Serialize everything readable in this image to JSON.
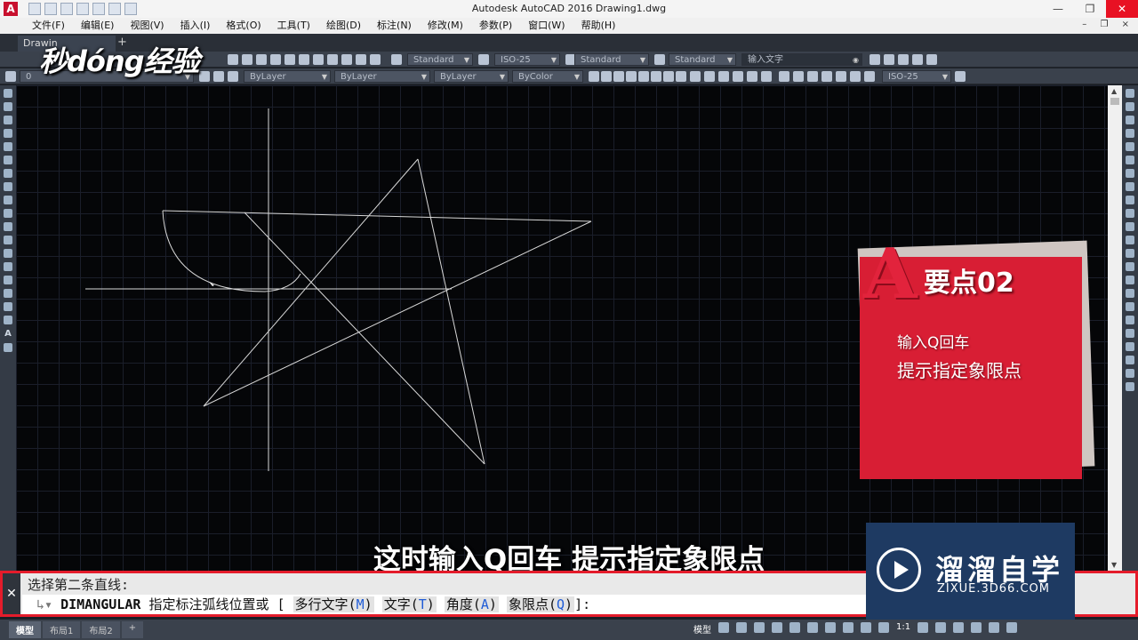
{
  "window": {
    "title": "Autodesk AutoCAD 2016    Drawing1.dwg",
    "controls": [
      "—",
      "❐",
      "✕"
    ]
  },
  "menu": {
    "items": [
      "文件(F)",
      "编辑(E)",
      "视图(V)",
      "插入(I)",
      "格式(O)",
      "工具(T)",
      "绘图(D)",
      "标注(N)",
      "修改(M)",
      "参数(P)",
      "窗口(W)",
      "帮助(H)"
    ]
  },
  "file_tab": {
    "label": "Drawin",
    "add": "+"
  },
  "watermark": {
    "text": "秒dóng经验"
  },
  "toolbar": {
    "text_style": "Standard",
    "dim_style": "ISO-25",
    "table_style": "Standard",
    "mleader_style": "Standard",
    "search_placeholder": "输入文字",
    "layer_current": "0",
    "color": "ByLayer",
    "linetype": "ByLayer",
    "lineweight": "ByLayer",
    "plotstyle": "ByColor",
    "dim_style_2": "ISO-25"
  },
  "left_tools": {
    "text_tool": "A"
  },
  "keypoint": {
    "big_letter": "A",
    "heading": "要点02",
    "line1": "输入Q回车",
    "line2": "提示指定象限点"
  },
  "subtitle": "这时输入Q回车 提示指定象限点",
  "brand": {
    "name": "溜溜自学",
    "url": "ZIXUE.3D66.COM"
  },
  "command": {
    "close": "✕",
    "history": "选择第二条直线:",
    "command_name": "DIMANGULAR",
    "prompt": "指定标注弧线位置或",
    "open_bracket": "[",
    "close_bracket": "]:",
    "options": [
      {
        "label": "多行文字",
        "key": "M"
      },
      {
        "label": "文字",
        "key": "T"
      },
      {
        "label": "角度",
        "key": "A"
      },
      {
        "label": "象限点",
        "key": "Q"
      }
    ]
  },
  "status": {
    "layout_tabs": [
      "模型",
      "布局1",
      "布局2"
    ],
    "add_tab": "+",
    "space": "模型",
    "scale": "1:1"
  },
  "colors": {
    "accent_red": "#d81e34",
    "canvas_bg": "#050608",
    "brand_blue": "#1e3a62",
    "command_border": "#e41c2b"
  }
}
